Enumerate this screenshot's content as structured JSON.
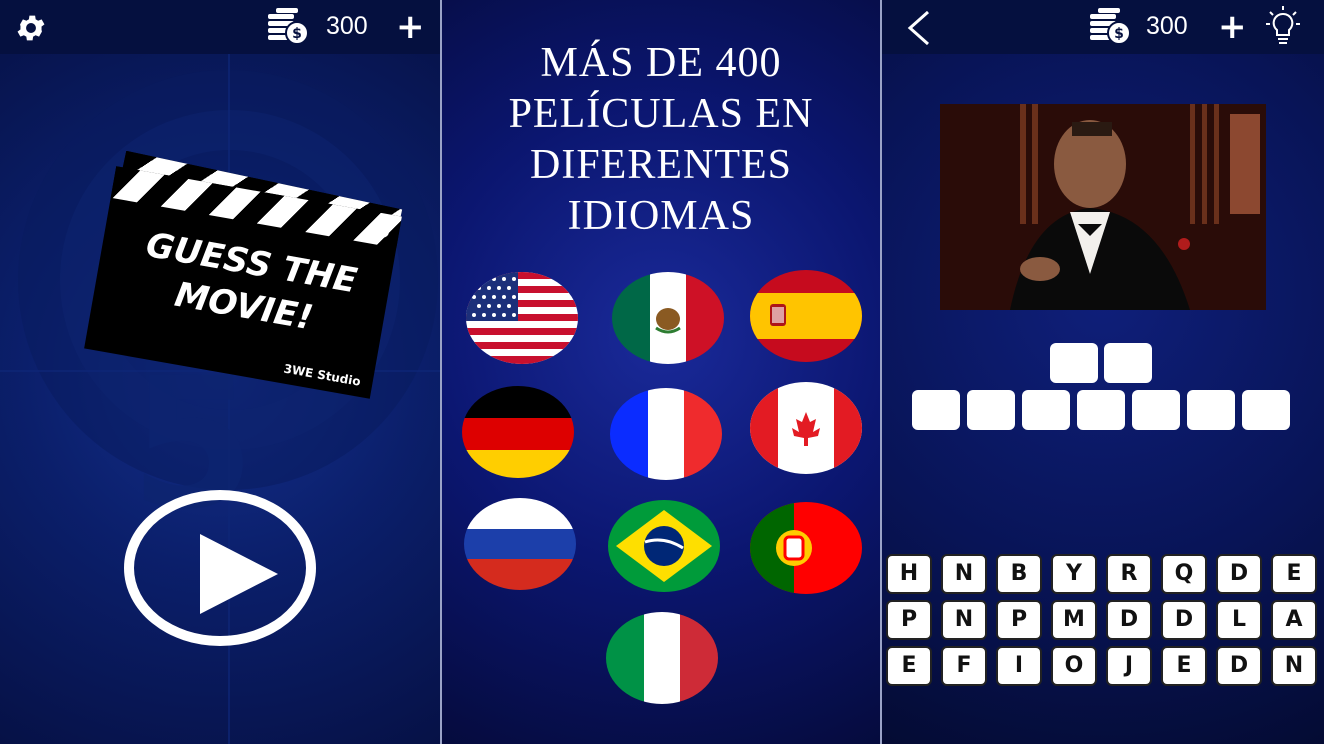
{
  "screen1": {
    "coins": "300",
    "logo_title_line1": "GUESS THE",
    "logo_title_line2": "MOVIE!",
    "studio": "3WE Studio"
  },
  "screen2": {
    "headline_lines": [
      "MÁS DE 400",
      "PELÍCULAS EN",
      "DIFERENTES",
      "IDIOMAS"
    ],
    "flags": [
      "usa",
      "mexico",
      "spain",
      "germany",
      "france",
      "canada",
      "russia",
      "brazil",
      "portugal",
      "italy"
    ]
  },
  "screen3": {
    "coins": "300",
    "answer_word_lengths": [
      2,
      7
    ],
    "keyboard": [
      [
        "H",
        "N",
        "B",
        "Y",
        "R",
        "Q",
        "D",
        "E"
      ],
      [
        "P",
        "N",
        "P",
        "M",
        "D",
        "D",
        "L",
        "A"
      ],
      [
        "E",
        "F",
        "I",
        "O",
        "J",
        "E",
        "D",
        "N"
      ]
    ]
  },
  "colors": {
    "topbar": "#05103f",
    "panel_bg": "#0b1f6b",
    "accent_white": "#ffffff"
  }
}
